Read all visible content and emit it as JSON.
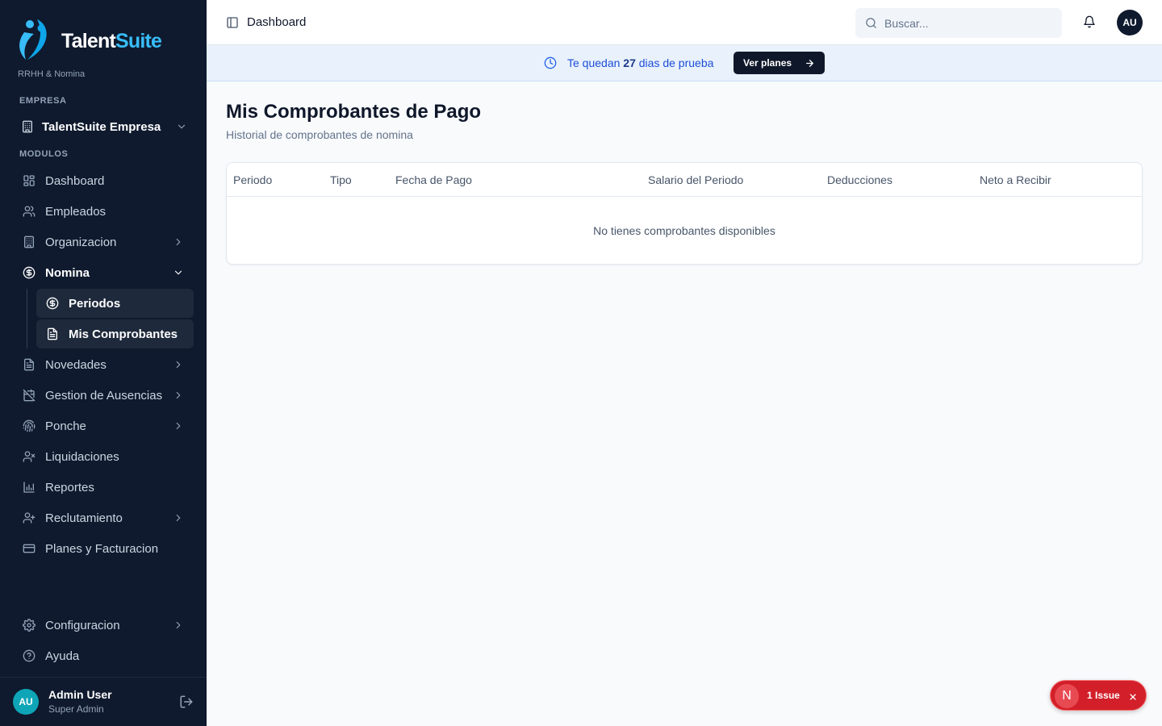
{
  "brand": {
    "name_part1": "Talent",
    "name_part2": "Suite",
    "subtitle": "RRHH & Nomina"
  },
  "sidebar": {
    "company_label": "EMPRESA",
    "company_name": "TalentSuite Empresa",
    "modules_label": "MODULOS",
    "items": [
      {
        "label": "Dashboard"
      },
      {
        "label": "Empleados"
      },
      {
        "label": "Organizacion"
      },
      {
        "label": "Nomina"
      },
      {
        "label": "Novedades"
      },
      {
        "label": "Gestion de Ausencias"
      },
      {
        "label": "Ponche"
      },
      {
        "label": "Liquidaciones"
      },
      {
        "label": "Reportes"
      },
      {
        "label": "Reclutamiento"
      },
      {
        "label": "Planes y Facturacion"
      }
    ],
    "nomina_subitems": [
      {
        "label": "Periodos"
      },
      {
        "label": "Mis Comprobantes"
      }
    ],
    "bottom_items": [
      {
        "label": "Configuracion"
      },
      {
        "label": "Ayuda"
      }
    ],
    "user": {
      "initials": "AU",
      "name": "Admin User",
      "role": "Super Admin"
    }
  },
  "header": {
    "title": "Dashboard",
    "search_placeholder": "Buscar...",
    "avatar_initials": "AU"
  },
  "banner": {
    "text_before": "Te quedan",
    "days": "27",
    "text_after": "dias de prueba",
    "button_label": "Ver planes"
  },
  "page": {
    "title": "Mis Comprobantes de Pago",
    "subtitle": "Historial de comprobantes de nomina"
  },
  "table": {
    "columns": [
      "Periodo",
      "Tipo",
      "Fecha de Pago",
      "Salario del Periodo",
      "Deducciones",
      "Neto a Recibir"
    ],
    "empty_message": "No tienes comprobantes disponibles"
  },
  "issue_badge": {
    "letter": "N",
    "label": "1 Issue"
  },
  "colors": {
    "sidebar_bg": "#0f1a2e",
    "brand_accent": "#38bdf8",
    "banner_bg": "#e8f1fc",
    "banner_text": "#1d4ed8",
    "issue_red": "#d21f2a"
  }
}
